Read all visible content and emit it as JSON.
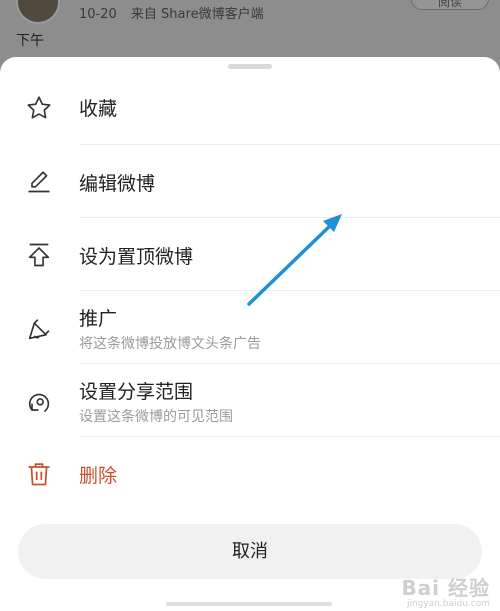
{
  "post": {
    "date": "10-20",
    "source": "来自 Share微博客户端",
    "read_label": "阅读",
    "text": "下午"
  },
  "sheet": {
    "items": [
      {
        "label": "收藏",
        "icon": "star-icon"
      },
      {
        "label": "编辑微博",
        "icon": "edit-pencil-icon"
      },
      {
        "label": "设为置顶微博",
        "icon": "pin-to-top-icon"
      },
      {
        "label": "推广",
        "sub": "将这条微博投放博文头条广告",
        "icon": "megaphone-icon"
      },
      {
        "label": "设置分享范围",
        "sub": "设置这条微博的可见范围",
        "icon": "share-scope-icon"
      },
      {
        "label": "删除",
        "icon": "trash-icon"
      }
    ],
    "cancel_label": "取消"
  },
  "colors": {
    "danger": "#c9502d",
    "annotation_arrow": "#1e90d8",
    "overlay": "#8d8d8d"
  },
  "watermark": {
    "main": "Bai 经验",
    "sub": "jingyan.baidu.com"
  }
}
